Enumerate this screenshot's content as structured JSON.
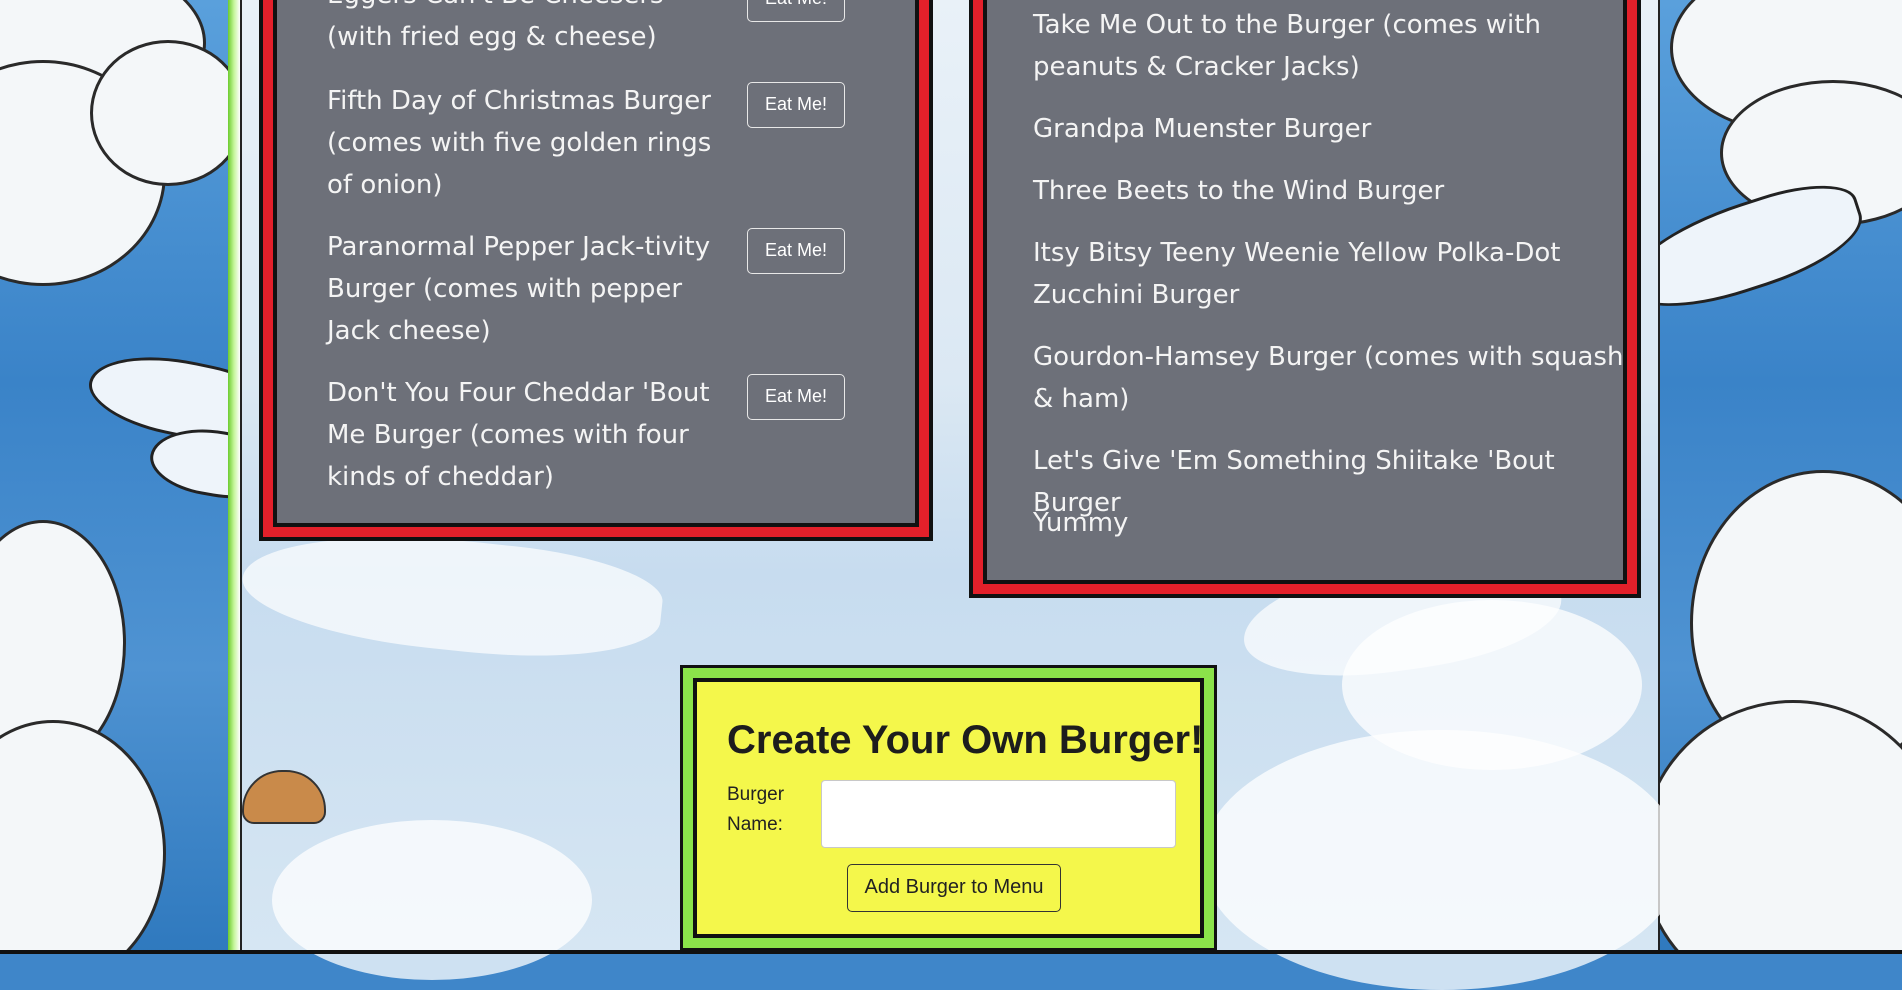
{
  "menu": {
    "uneaten": [
      {
        "name": "Eggers Can't Be Cheesers (with fried egg & cheese)",
        "button": "Eat Me!"
      },
      {
        "name": "Fifth Day of Christmas Burger (comes with five golden rings of onion)",
        "button": "Eat Me!"
      },
      {
        "name": "Paranormal Pepper Jack-tivity Burger (comes with pepper Jack cheese)",
        "button": "Eat Me!"
      },
      {
        "name": "Don't You Four Cheddar 'Bout Me Burger (comes with four kinds of cheddar)",
        "button": "Eat Me!"
      }
    ],
    "eaten": [
      "Take Me Out to the Burger (comes with peanuts & Cracker Jacks)",
      "Grandpa Muenster Burger",
      "Three Beets to the Wind Burger",
      "Itsy Bitsy Teeny Weenie Yellow Polka-Dot Zucchini Burger",
      "Gourdon-Hamsey Burger (comes with squash & ham)",
      "Let's Give 'Em Something Shiitake 'Bout Burger",
      "Yummy"
    ]
  },
  "create_form": {
    "title": "Create Your Own Burger!",
    "label": "Burger Name:",
    "input_value": "",
    "submit_label": "Add Burger to Menu"
  },
  "colors": {
    "panel_bg": "#6d7079",
    "panel_border": "#e4202a",
    "form_bg": "#f4f74b",
    "form_border": "#8be34a"
  }
}
